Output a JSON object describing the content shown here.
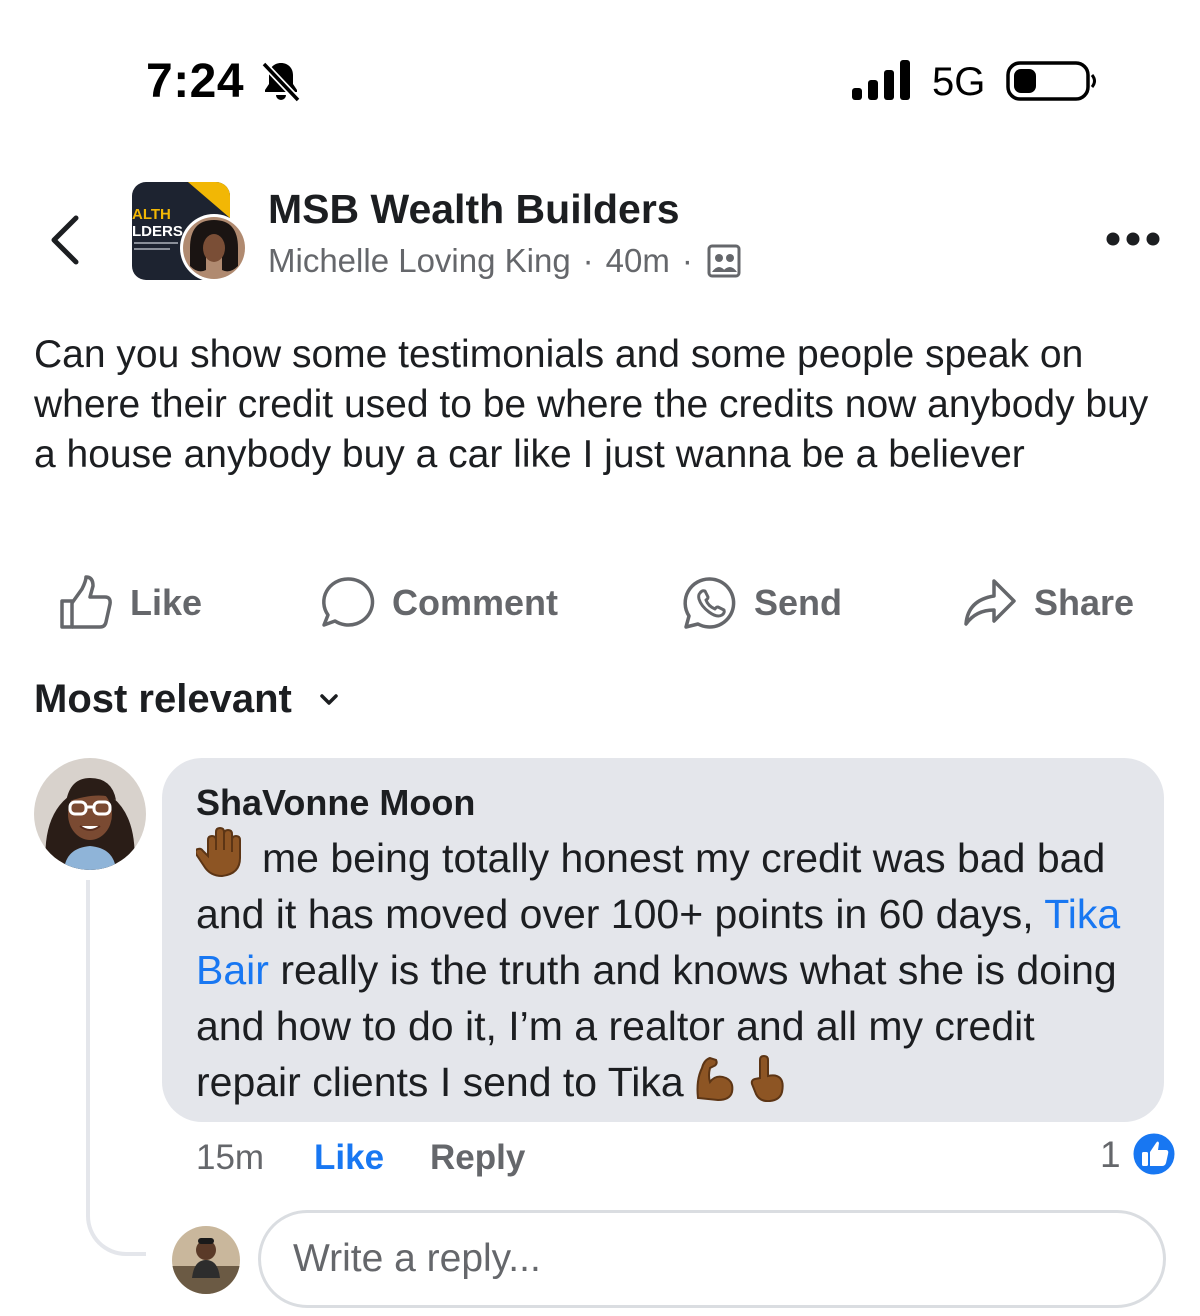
{
  "status_bar": {
    "time": "7:24",
    "network": "5G",
    "icons": [
      "bell-slash-icon",
      "signal-bars-icon",
      "battery-icon"
    ]
  },
  "header": {
    "group_name": "MSB Wealth Builders",
    "author": "Michelle Loving King",
    "separator": "·",
    "age": "40m",
    "logo_text_line1": "ALTH",
    "logo_text_line2": "LDERS",
    "icons": [
      "back-chevron-icon",
      "group-privacy-icon",
      "more-options-icon"
    ]
  },
  "post": {
    "text": "Can you show some testimonials and some people speak on where their credit used to be where the credits now anybody buy a house anybody buy a car like I just wanna be a believer"
  },
  "actions": {
    "like": "Like",
    "comment": "Comment",
    "send": "Send",
    "share": "Share"
  },
  "sort": {
    "label": "Most relevant"
  },
  "comment": {
    "author": "ShaVonne Moon",
    "text_part1": "me being totally honest my credit was bad bad and it has moved over 100+ points in 60 days,",
    "mention": "Tika Bair",
    "text_part2": "really is the truth and knows what she is doing and how to do it, I’m a realtor and all my credit repair clients I send to Tika",
    "emojis": [
      "raised-hand",
      "flexed-biceps",
      "index-pointing-up"
    ],
    "time": "15m",
    "like_label": "Like",
    "reply_label": "Reply",
    "reaction_count": "1",
    "reaction_type": "like",
    "colors": {
      "mention": "#1877f2",
      "bubble": "#e4e6eb",
      "like_active": "#1877f2"
    }
  },
  "reply_box": {
    "placeholder": "Write a reply..."
  }
}
